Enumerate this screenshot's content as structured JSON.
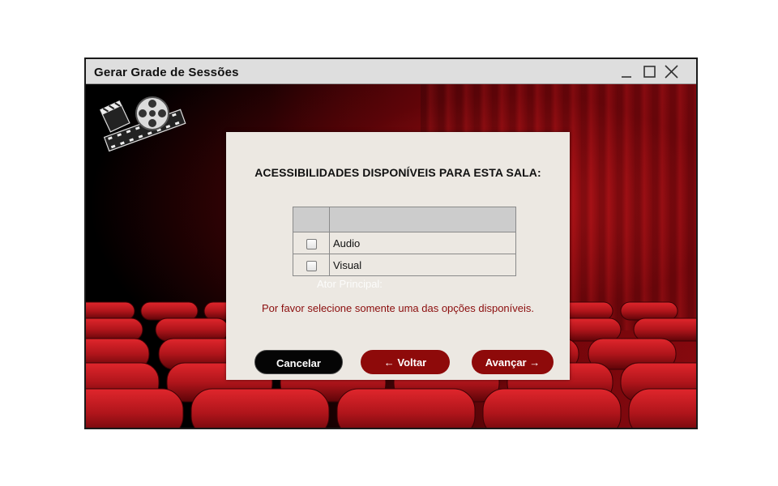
{
  "window": {
    "title": "Gerar Grade de Sessões"
  },
  "dialog": {
    "heading": "ACESSIBILIDADES DISPONÍVEIS PARA ESTA SALA:",
    "table": {
      "rows": [
        {
          "label": "Audio",
          "checked": false
        },
        {
          "label": "Visual",
          "checked": false
        }
      ]
    },
    "ghost_label": "Ator Principal:",
    "warning": "Por favor selecione somente uma das opções disponíveis.",
    "buttons": {
      "cancel": "Cancelar",
      "back": "← Voltar",
      "next": "Avançar →"
    }
  },
  "icons": {
    "minimize": "minimize-icon",
    "maximize": "maximize-icon",
    "close": "close-icon",
    "logo": "film-reel-clapperboard-logo"
  },
  "colors": {
    "accent": "#8e0a0a",
    "warning_text": "#8b0d0d",
    "dialog_bg": "#ece8e2",
    "titlebar_bg": "#dedede"
  }
}
